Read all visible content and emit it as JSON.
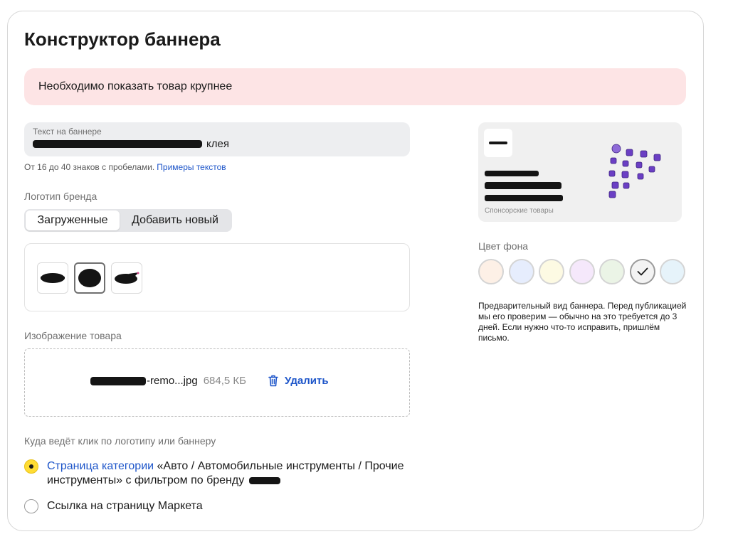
{
  "title": "Конструктор баннера",
  "alert": "Необходимо показать товар крупнее",
  "banner_text": {
    "label": "Текст на баннере",
    "value_suffix": "клея",
    "hint": "От 16 до 40 знаков с пробелами.",
    "hint_link": "Примеры текстов"
  },
  "logo_section": {
    "label": "Логотип бренда",
    "tabs": [
      {
        "label": "Загруженные",
        "active": true
      },
      {
        "label": "Добавить новый",
        "active": false
      }
    ],
    "thumbs": [
      {
        "selected": false,
        "icon": "logo-thumbnail"
      },
      {
        "selected": true,
        "icon": "logo-thumbnail"
      },
      {
        "selected": false,
        "icon": "logo-thumbnail"
      }
    ]
  },
  "product_image": {
    "label": "Изображение товара",
    "file_name_suffix": "-remo...jpg",
    "file_size": "684,5 КБ",
    "delete_label": "Удалить",
    "delete_icon": "trash-icon"
  },
  "click_target": {
    "label": "Куда ведёт клик по логотипу или баннеру",
    "options": [
      {
        "selected": true,
        "link_text": "Страница категории",
        "text_line1": "«Авто / Автомобильные инструменты / Прочие",
        "text_line2": "инструменты» с фильтром по бренду"
      },
      {
        "selected": false,
        "text": "Ссылка на страницу Маркета"
      }
    ]
  },
  "preview": {
    "sponsor_text": "Спонсорские товары"
  },
  "background_color": {
    "label": "Цвет фона",
    "swatches": [
      {
        "color": "#fdf0e6",
        "selected": false
      },
      {
        "color": "#e6edfd",
        "selected": false
      },
      {
        "color": "#fdfae3",
        "selected": false
      },
      {
        "color": "#f5e8fb",
        "selected": false
      },
      {
        "color": "#ebf4e6",
        "selected": false
      },
      {
        "color": "#f3f3f3",
        "selected": true
      },
      {
        "color": "#e6f3fa",
        "selected": false
      }
    ]
  },
  "description": "Предварительный вид баннера. Перед публикацией мы его проверим — обычно на это требуется до 3 дней. Если нужно что-то исправить, пришлём письмо.",
  "colors": {
    "link": "#1d55c9",
    "alert_bg": "#fde4e5",
    "radio_selected": "#ffdc33"
  }
}
